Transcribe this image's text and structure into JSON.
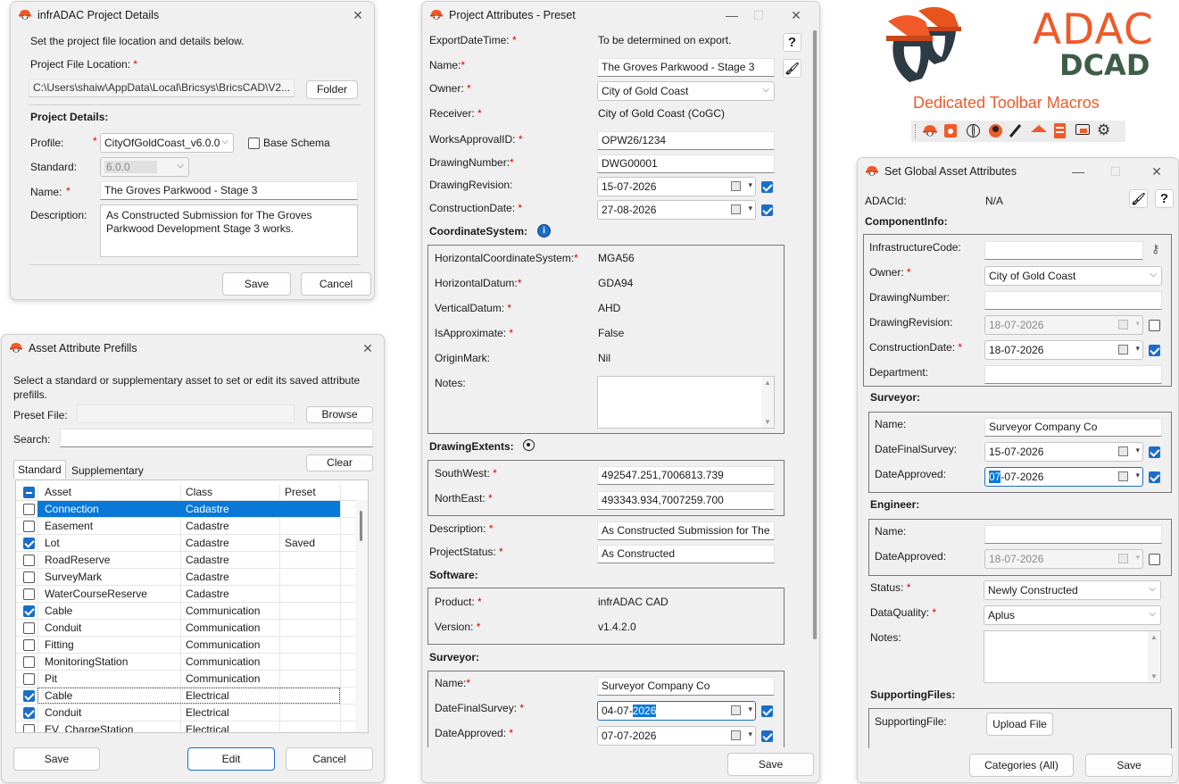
{
  "colors": {
    "accent": "#1b6ec8",
    "selection": "#0a78d7",
    "required": "#dd0000",
    "brand_orange": "#f05a28",
    "brand_green": "#3e5d48"
  },
  "project_details": {
    "title": "infrADAC Project Details",
    "intro": "Set the project file location and details below.",
    "file_location_label": "Project File Location:",
    "file_location_value": "C:\\Users\\shaiw\\AppData\\Local\\Bricsys\\BricsCAD\\V2...",
    "folder_button": "Folder",
    "section": "Project Details:",
    "profile_label": "Profile:",
    "profile_value": "CityOfGoldCoast_v6.0.0",
    "base_schema_label": "Base Schema",
    "standard_label": "Standard:",
    "standard_value": "6.0.0",
    "name_label": "Name:",
    "name_value": "The Groves Parkwood - Stage 3",
    "description_label": "Description:",
    "description_value": "As Constructed Submission for The Groves Parkwood Development Stage 3 works.",
    "save": "Save",
    "cancel": "Cancel"
  },
  "prefills": {
    "title": "Asset Attribute Prefills",
    "intro": "Select a standard or supplementary asset to set or edit its saved attribute prefills.",
    "preset_file_label": "Preset File:",
    "browse": "Browse",
    "search_label": "Search:",
    "tabs": [
      "Standard",
      "Supplementary"
    ],
    "clear": "Clear",
    "columns": [
      "Asset",
      "Class",
      "Preset"
    ],
    "rows": [
      {
        "asset": "Connection",
        "class": "Cadastre",
        "preset": "",
        "checked": false
      },
      {
        "asset": "Easement",
        "class": "Cadastre",
        "preset": "",
        "checked": false
      },
      {
        "asset": "Lot",
        "class": "Cadastre",
        "preset": "Saved",
        "checked": true
      },
      {
        "asset": "RoadReserve",
        "class": "Cadastre",
        "preset": "",
        "checked": false
      },
      {
        "asset": "SurveyMark",
        "class": "Cadastre",
        "preset": "",
        "checked": false
      },
      {
        "asset": "WaterCourseReserve",
        "class": "Cadastre",
        "preset": "",
        "checked": false
      },
      {
        "asset": "Cable",
        "class": "Communication",
        "preset": "",
        "checked": true
      },
      {
        "asset": "Conduit",
        "class": "Communication",
        "preset": "",
        "checked": false
      },
      {
        "asset": "Fitting",
        "class": "Communication",
        "preset": "",
        "checked": false
      },
      {
        "asset": "MonitoringStation",
        "class": "Communication",
        "preset": "",
        "checked": false
      },
      {
        "asset": "Pit",
        "class": "Communication",
        "preset": "",
        "checked": false
      },
      {
        "asset": "Cable",
        "class": "Electrical",
        "preset": "",
        "checked": true
      },
      {
        "asset": "Conduit",
        "class": "Electrical",
        "preset": "",
        "checked": true
      },
      {
        "asset": "EV_ChargeStation",
        "class": "Electrical",
        "preset": "",
        "checked": false
      }
    ],
    "save": "Save",
    "edit": "Edit",
    "cancel": "Cancel"
  },
  "project_attributes": {
    "title": "Project Attributes - Preset",
    "export_date_label": "ExportDateTime:",
    "export_date_value": "To be determined on export.",
    "name_label": "Name:",
    "name_value": "The Groves Parkwood - Stage 3",
    "owner_label": "Owner:",
    "owner_value": "City of Gold Coast",
    "receiver_label": "Receiver:",
    "receiver_value": "City of Gold Coast (CoGC)",
    "works_label": "WorksApprovalID:",
    "works_value": "OPW26/1234",
    "drawing_number_label": "DrawingNumber:",
    "drawing_number_value": "DWG00001",
    "drawing_revision_label": "DrawingRevision:",
    "drawing_revision_value": "15-07-2026",
    "construction_date_label": "ConstructionDate:",
    "construction_date_value": "27-08-2026",
    "coord_section": "CoordinateSystem:",
    "hcs_label": "HorizontalCoordinateSystem:",
    "hcs_value": "MGA56",
    "hd_label": "HorizontalDatum:",
    "hd_value": "GDA94",
    "vd_label": "VerticalDatum:",
    "vd_value": "AHD",
    "approx_label": "IsApproximate:",
    "approx_value": "False",
    "origin_label": "OriginMark:",
    "origin_value": "Nil",
    "notes_label": "Notes:",
    "extents_section": "DrawingExtents:",
    "sw_label": "SouthWest:",
    "sw_value": "492547.251,7006813.739",
    "ne_label": "NorthEast:",
    "ne_value": "493343.934,7007259.700",
    "desc_label": "Description:",
    "desc_value": "As Constructed Submission for The",
    "status_label": "ProjectStatus:",
    "status_value": "As Constructed",
    "software_section": "Software:",
    "product_label": "Product:",
    "product_value": "infrADAC CAD",
    "version_label": "Version:",
    "version_value": "v1.4.2.0",
    "surveyor_section": "Surveyor:",
    "sname_label": "Name:",
    "sname_value": "Surveyor Company Co",
    "dfs_label": "DateFinalSurvey:",
    "dfs_value_prefix": "04-07-",
    "dfs_value_selected": "2026",
    "da_label": "DateApproved:",
    "da_value": "07-07-2026",
    "save": "Save",
    "help": "?"
  },
  "branding": {
    "adac": "ADAC",
    "dcad": "DCAD",
    "tagline": "Dedicated Toolbar Macros",
    "toolbar_icons": [
      "adac-logo-icon",
      "camera-icon",
      "globe-icon",
      "user-icon",
      "wand-icon",
      "house-icon",
      "pdf-icon",
      "chat-icon",
      "gear-icon"
    ]
  },
  "global_attributes": {
    "title": "Set Global Asset Attributes",
    "adacid_label": "ADACId:",
    "adacid_value": "N/A",
    "component_section": "ComponentInfo:",
    "infra_label": "InfrastructureCode:",
    "owner_label": "Owner:",
    "owner_value": "City of Gold Coast",
    "drawing_number_label": "DrawingNumber:",
    "drawing_revision_label": "DrawingRevision:",
    "drawing_revision_value": "18-07-2026",
    "construction_date_label": "ConstructionDate:",
    "construction_date_value": "18-07-2026",
    "department_label": "Department:",
    "surveyor_section": "Surveyor:",
    "sname_label": "Name:",
    "sname_value": "Surveyor Company Co",
    "dfs_label": "DateFinalSurvey:",
    "dfs_value": "15-07-2026",
    "da_label": "DateApproved:",
    "da_value_selected": "07",
    "da_value_rest": "-07-2026",
    "engineer_section": "Engineer:",
    "ename_label": "Name:",
    "eda_label": "DateApproved:",
    "eda_value": "18-07-2026",
    "status_label": "Status:",
    "status_value": "Newly Constructed",
    "quality_label": "DataQuality:",
    "quality_value": "Aplus",
    "notes_label": "Notes:",
    "supporting_section": "SupportingFiles:",
    "supporting_file_label": "SupportingFile:",
    "upload": "Upload File",
    "categories": "Categories (All)",
    "save": "Save",
    "help": "?"
  }
}
